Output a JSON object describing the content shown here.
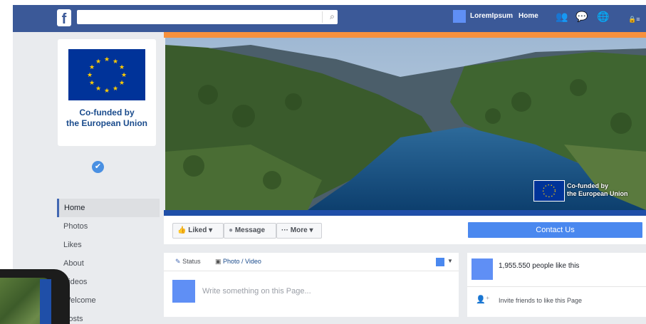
{
  "header": {
    "logo": "f",
    "search_placeholder": "",
    "search_icon": "search-icon",
    "user_name": "LoremIpsum",
    "home_label": "Home",
    "icons": [
      "friends-icon",
      "messages-icon",
      "globe-icon",
      "lock-icon"
    ]
  },
  "left_panel": {
    "eu_label_line1": "Co-funded by",
    "eu_label_line2": "the European Union",
    "nav": [
      "Home",
      "Photos",
      "Likes",
      "About",
      "Videos",
      "Welcome",
      "Posts"
    ],
    "active_nav": "Home"
  },
  "cover": {
    "eu_label_line1": "Co-funded by",
    "eu_label_line2": "the European Union"
  },
  "actions": {
    "liked": "Liked ▾",
    "message": "Message",
    "more": "··· More ▾",
    "contact": "Contact Us"
  },
  "composer": {
    "status_tab": "Status",
    "photo_tab": "Photo / Video",
    "placeholder": "Write something on this Page..."
  },
  "likes": {
    "count_text": "1,955.550 people like this",
    "invite_text": "Invite friends to like this Page"
  },
  "colors": {
    "facebook_blue": "#3b5998",
    "accent_blue": "#4a88ef",
    "orange": "#f7913d",
    "eu_blue": "#003399",
    "eu_gold": "#ffcc00"
  }
}
